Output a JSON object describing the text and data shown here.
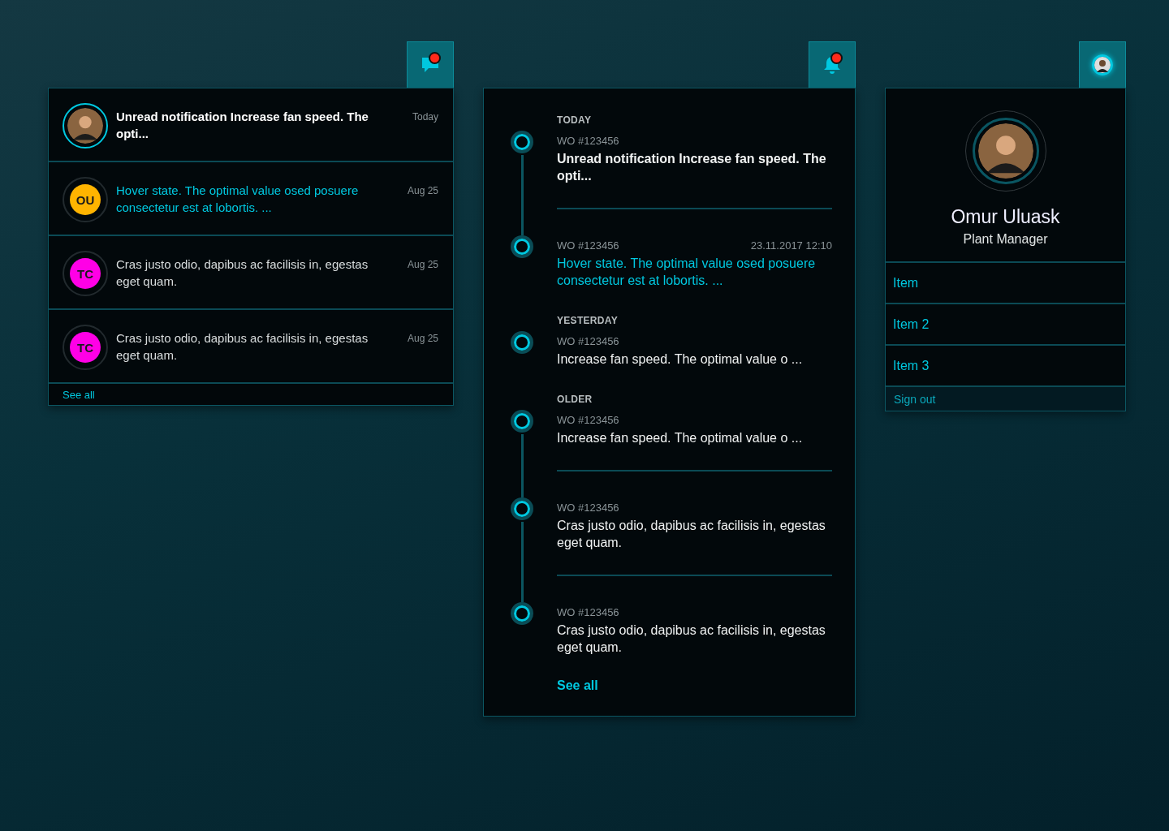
{
  "messages": {
    "trigger": {
      "kind": "chat",
      "dot": true
    },
    "rows": [
      {
        "kind": "unread",
        "text": "Unread notification Increase fan speed. The opti...",
        "date": "Today"
      },
      {
        "kind": "hover",
        "initials": "OU",
        "color": "#ffb400",
        "text": "Hover state. The optimal value osed posuere consectetur est at lobortis. ...",
        "date": "Aug 25"
      },
      {
        "kind": "read",
        "initials": "TC",
        "color": "#ff00e6",
        "text": "Cras justo odio, dapibus ac facilisis in, egestas eget quam.",
        "date": "Aug 25"
      },
      {
        "kind": "read",
        "initials": "TC",
        "color": "#ff00e6",
        "text": "Cras justo odio, dapibus ac facilisis in, egestas eget quam.",
        "date": "Aug 25"
      }
    ],
    "see_all": "See all"
  },
  "notifications": {
    "trigger": {
      "kind": "bell",
      "dot": true
    },
    "sections": [
      {
        "heading": "TODAY",
        "entries": [
          {
            "kind": "unread",
            "wo": "WO #123456",
            "text": "Unread notification Increase fan speed. The opti..."
          },
          {
            "kind": "hover",
            "wo": "WO #123456",
            "timestamp": "23.11.2017 12:10",
            "text": "Hover state. The optimal value osed posuere consectetur est at lobortis. ..."
          }
        ]
      },
      {
        "heading": "YESTERDAY",
        "entries": [
          {
            "kind": "read",
            "wo": "WO #123456",
            "text": "Increase fan speed. The optimal value o ..."
          }
        ]
      },
      {
        "heading": "OLDER",
        "entries": [
          {
            "kind": "read",
            "wo": "WO #123456",
            "text": "Increase fan speed. The optimal value o ..."
          },
          {
            "kind": "read",
            "wo": "WO #123456",
            "text": "Cras justo odio, dapibus ac facilisis in, egestas eget quam."
          },
          {
            "kind": "read",
            "wo": "WO #123456",
            "text": "Cras justo odio, dapibus ac facilisis in, egestas eget quam."
          }
        ]
      }
    ],
    "see_all": "See all"
  },
  "profile": {
    "trigger": {
      "kind": "avatar"
    },
    "name": "Omur Uluask",
    "role": "Plant Manager",
    "items": [
      "Item",
      "Item 2",
      "Item 3"
    ],
    "sign_out": "Sign out"
  }
}
